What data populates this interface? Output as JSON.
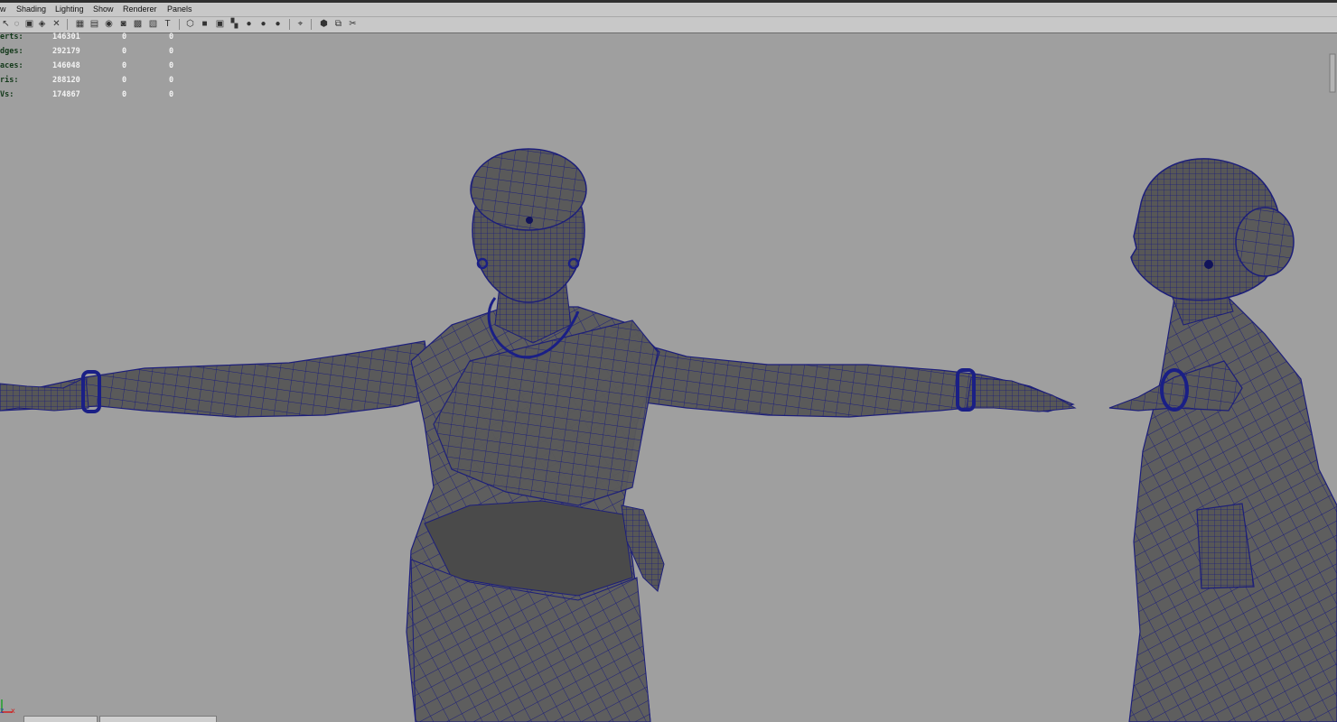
{
  "menu": {
    "items": [
      {
        "label": "w"
      },
      {
        "label": "Shading"
      },
      {
        "label": "Lighting"
      },
      {
        "label": "Show"
      },
      {
        "label": "Renderer"
      },
      {
        "label": "Panels"
      }
    ]
  },
  "toolbar": {
    "icons": [
      "select-icon",
      "lasso-icon",
      "camera-icon",
      "bookmark-icon",
      "image-plane-icon",
      "2d-pan-icon",
      "grid-icon",
      "film-gate-icon",
      "resolution-gate-icon",
      "gate-mask-icon",
      "field-chart-icon",
      "safe-action-icon",
      "safe-title-icon",
      "wireframe-icon",
      "smooth-shade-icon",
      "wireframe-on-shaded-icon",
      "textured-icon",
      "use-lights-icon",
      "shadows-icon",
      "ambient-occlusion-icon",
      "isolate-select-icon",
      "xray-icon",
      "xray-joints-icon",
      "xray-components-icon"
    ]
  },
  "hud": {
    "rows": [
      {
        "label": "erts:",
        "values": [
          "146301",
          "0",
          "0"
        ]
      },
      {
        "label": "dges:",
        "values": [
          "292179",
          "0",
          "0"
        ]
      },
      {
        "label": "aces:",
        "values": [
          "146048",
          "0",
          "0"
        ]
      },
      {
        "label": "ris:",
        "values": [
          "288120",
          "0",
          "0"
        ]
      },
      {
        "label": "Vs:",
        "values": [
          "174867",
          "0",
          "0"
        ]
      }
    ]
  },
  "axis": {
    "z": "z",
    "x": "x"
  },
  "colors": {
    "background": "#9f9f9f",
    "mesh_fill": "#5a5a5a",
    "wireframe": "#1c1e7a",
    "hud_label": "#13391a",
    "hud_value": "#f4f4f4"
  }
}
